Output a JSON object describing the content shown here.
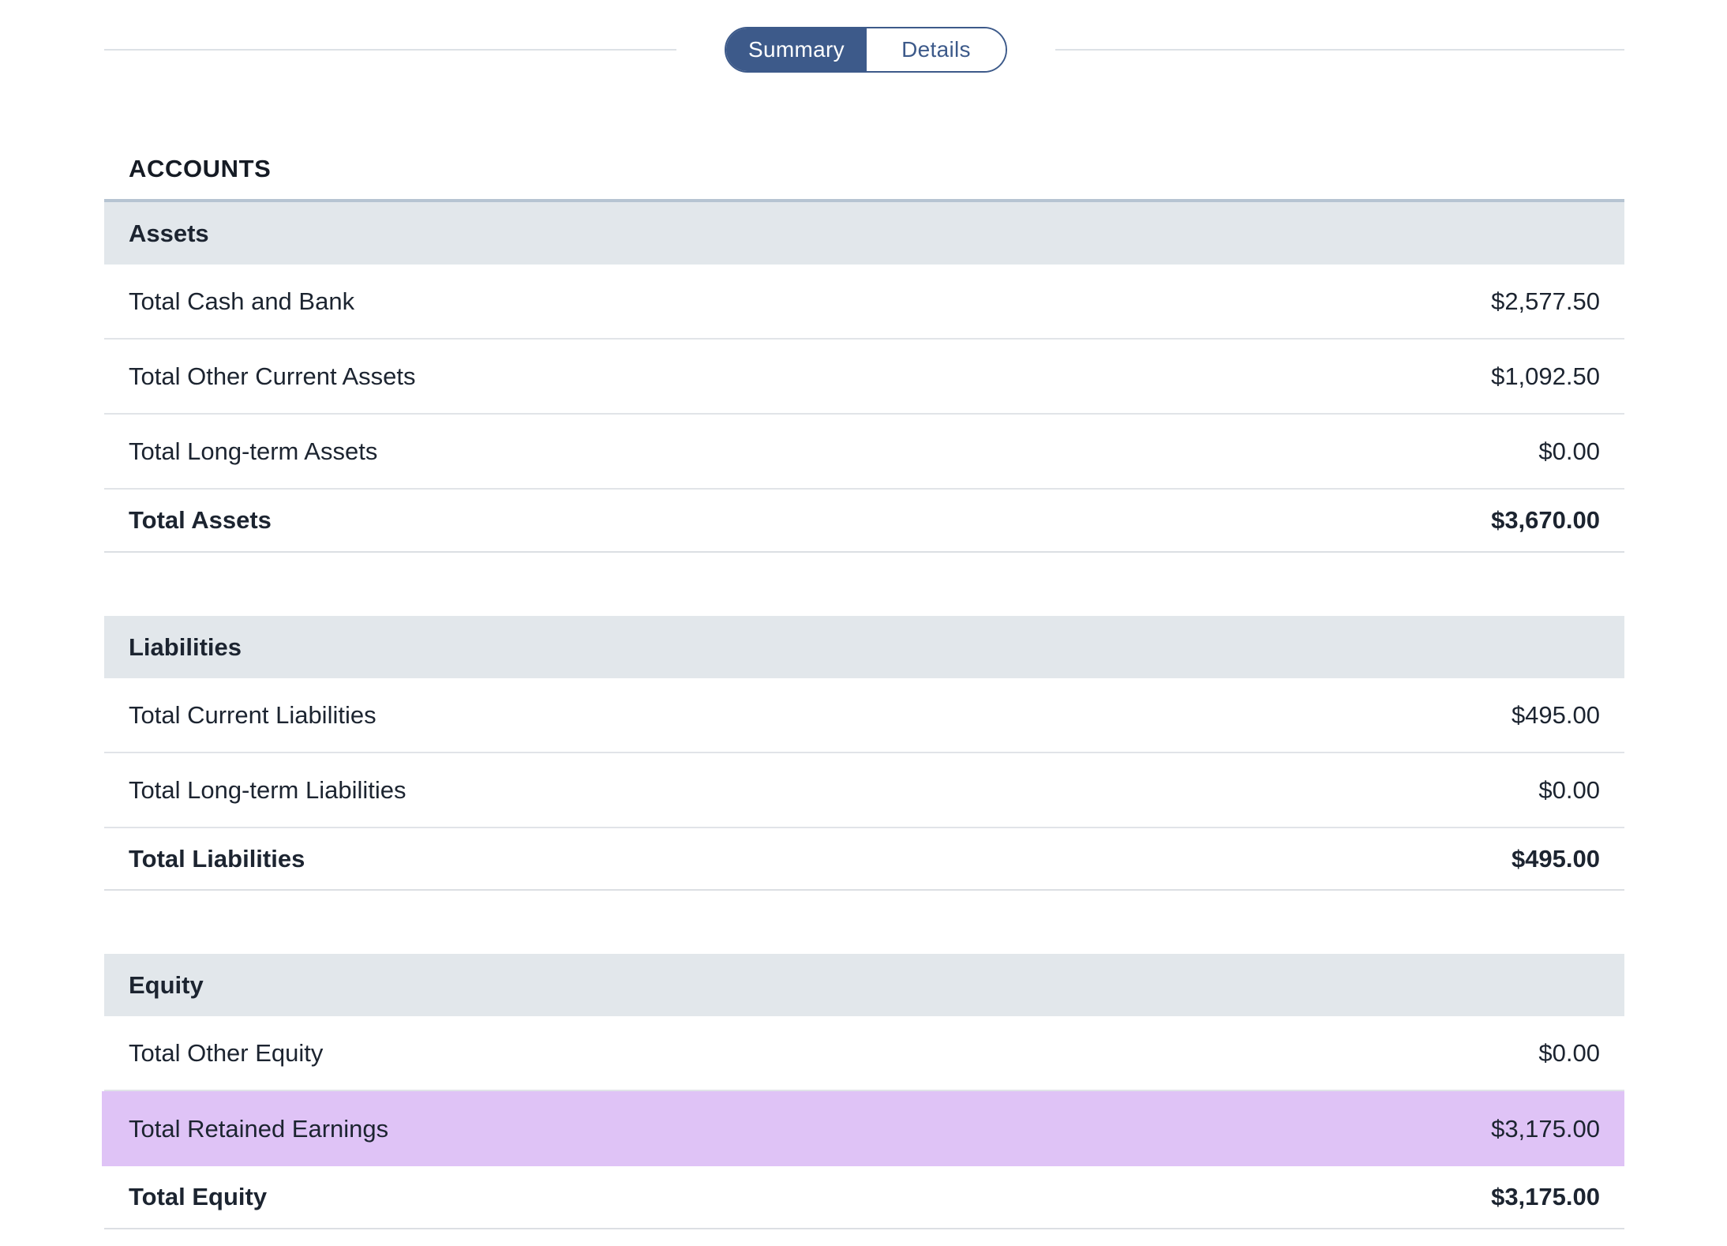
{
  "toggle": {
    "summary_label": "Summary",
    "details_label": "Details",
    "active": "Summary"
  },
  "accounts_title": "ACCOUNTS",
  "sections": {
    "assets": {
      "title": "Assets",
      "rows": [
        {
          "label": "Total Cash and Bank",
          "amount": "$2,577.50"
        },
        {
          "label": "Total Other Current Assets",
          "amount": "$1,092.50"
        },
        {
          "label": "Total Long-term Assets",
          "amount": "$0.00"
        }
      ],
      "total": {
        "label": "Total Assets",
        "amount": "$3,670.00"
      }
    },
    "liabilities": {
      "title": "Liabilities",
      "rows": [
        {
          "label": "Total Current Liabilities",
          "amount": "$495.00"
        },
        {
          "label": "Total Long-term Liabilities",
          "amount": "$0.00"
        }
      ],
      "total": {
        "label": "Total Liabilities",
        "amount": "$495.00"
      }
    },
    "equity": {
      "title": "Equity",
      "rows": [
        {
          "label": "Total Other Equity",
          "amount": "$0.00"
        },
        {
          "label": "Total Retained Earnings",
          "amount": "$3,175.00",
          "highlighted": true
        }
      ],
      "total": {
        "label": "Total Equity",
        "amount": "$3,175.00"
      }
    }
  },
  "colors": {
    "accent": "#3d5a8a",
    "section_header_bg": "#e2e7eb",
    "highlight_bg": "#dfc3f6"
  }
}
